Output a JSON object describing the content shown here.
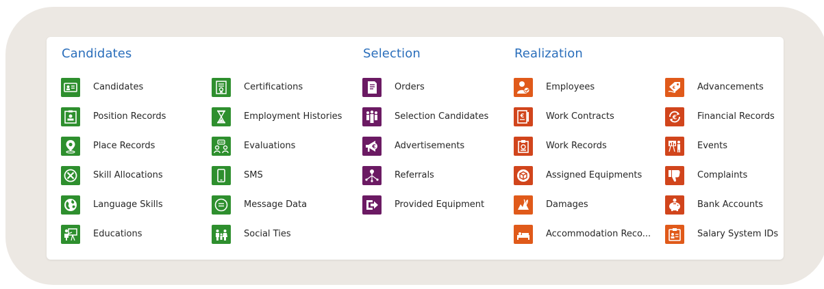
{
  "colors": {
    "candidates": "#2e8f2e",
    "selection": "#6b1a63",
    "realization": "#e05a1a",
    "heading": "#2a6ebb",
    "frame": "#ece8e3"
  },
  "sections": {
    "candidates": "Candidates",
    "selection": "Selection",
    "realization": "Realization"
  },
  "candidates_col1": [
    {
      "label": "Candidates",
      "icon": "id-card-icon"
    },
    {
      "label": "Position Records",
      "icon": "badge-icon"
    },
    {
      "label": "Place Records",
      "icon": "map-pin-icon"
    },
    {
      "label": "Skill Allocations",
      "icon": "tools-icon"
    },
    {
      "label": "Language Skills",
      "icon": "globe-icon"
    },
    {
      "label": "Educations",
      "icon": "teacher-board-icon"
    }
  ],
  "candidates_col2": [
    {
      "label": "Certifications",
      "icon": "certificate-icon"
    },
    {
      "label": "Employment Histories",
      "icon": "hourglass-icon"
    },
    {
      "label": "Evaluations",
      "icon": "speech-people-icon"
    },
    {
      "label": "SMS",
      "icon": "phone-icon"
    },
    {
      "label": "Message Data",
      "icon": "message-bubble-icon"
    },
    {
      "label": "Social Ties",
      "icon": "family-icon"
    }
  ],
  "selection": [
    {
      "label": "Orders",
      "icon": "document-icon"
    },
    {
      "label": "Selection Candidates",
      "icon": "group-icon"
    },
    {
      "label": "Advertisements",
      "icon": "megaphone-icon"
    },
    {
      "label": "Referrals",
      "icon": "referral-network-icon"
    },
    {
      "label": "Provided Equipment",
      "icon": "arrow-out-icon"
    }
  ],
  "realization_col1": [
    {
      "label": "Employees",
      "icon": "employee-check-icon"
    },
    {
      "label": "Work Contracts",
      "icon": "contract-icon"
    },
    {
      "label": "Work Records",
      "icon": "clipboard-icon"
    },
    {
      "label": "Assigned Equipments",
      "icon": "box-icon"
    },
    {
      "label": "Damages",
      "icon": "fire-damage-icon"
    },
    {
      "label": "Accommodation Reco...",
      "icon": "bed-icon"
    }
  ],
  "realization_col2": [
    {
      "label": "Advancements",
      "icon": "money-tag-icon"
    },
    {
      "label": "Financial Records",
      "icon": "euro-cycle-icon"
    },
    {
      "label": "Events",
      "icon": "presentation-icon"
    },
    {
      "label": "Complaints",
      "icon": "thumbs-down-icon"
    },
    {
      "label": "Bank Accounts",
      "icon": "piggy-bank-icon"
    },
    {
      "label": "Salary System IDs",
      "icon": "id-badge-icon"
    }
  ]
}
